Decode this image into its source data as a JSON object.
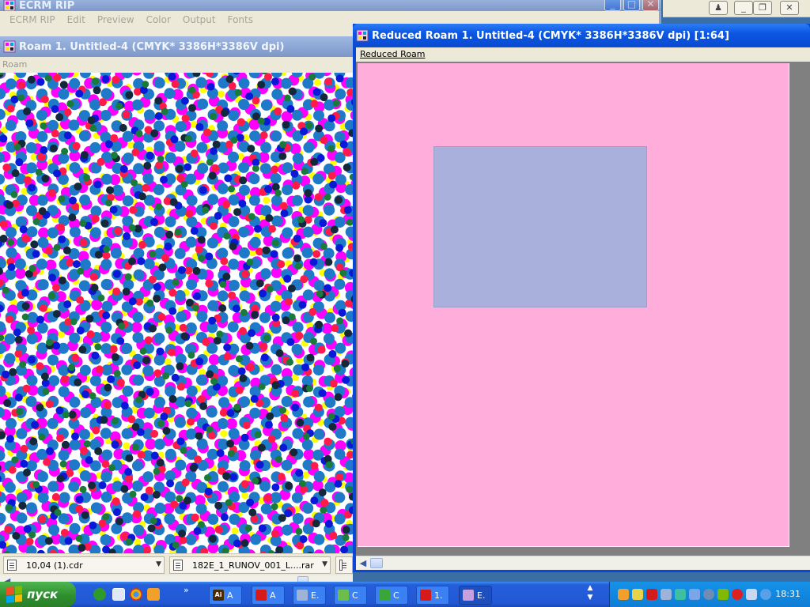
{
  "ecrm": {
    "title": "ECRM RIP",
    "menu": [
      "ECRM RIP",
      "Edit",
      "Preview",
      "Color",
      "Output",
      "Fonts"
    ]
  },
  "roam": {
    "title": "Roam 1. Untitled-4  (CMYK* 3386H*3386V dpi)",
    "menu_label": "Roam"
  },
  "reduced": {
    "title": "Reduced Roam 1. Untitled-4  (CMYK* 3386H*3386V dpi)  [1:64]",
    "menu_label": "Reduced Roam",
    "paper_color": "#ffaedb",
    "viewport_color": "#aab0dc"
  },
  "doc_tabs": [
    {
      "label": "10,04 (1).cdr"
    },
    {
      "label": "182E_1_RUNOV_001_L....rar"
    }
  ],
  "taskbar": {
    "start_label": "пуск",
    "buttons": [
      {
        "label": "A",
        "icon": "illustrator-icon",
        "icon_text": "Ai",
        "color": "#4a2a00"
      },
      {
        "label": "A",
        "icon": "acrobat-icon",
        "icon_text": "",
        "color": "#d41a1a"
      },
      {
        "label": "E.",
        "icon": "window-icon",
        "icon_text": "",
        "color": "#9fb3d8"
      },
      {
        "label": "C",
        "icon": "corel-icon",
        "icon_text": "",
        "color": "#6cbd4a"
      },
      {
        "label": "C",
        "icon": "browser-icon",
        "icon_text": "",
        "color": "#3aa63a"
      },
      {
        "label": "1.",
        "icon": "acrobat-icon",
        "icon_text": "",
        "color": "#d41a1a"
      },
      {
        "label": "E.",
        "icon": "ecrm-icon",
        "icon_text": "",
        "color": "#c8a0e0"
      }
    ],
    "clock": "18:31"
  },
  "colors": {
    "cyan": "#1e7ac8",
    "magenta": "#ff00ff",
    "yellow": "#ffff00",
    "red": "#ff1a4a",
    "blue": "#0a18d8",
    "dark": "#14283c",
    "green": "#1a7a3a"
  }
}
